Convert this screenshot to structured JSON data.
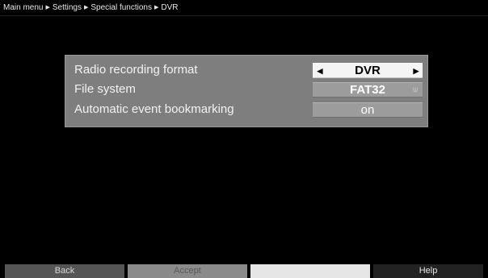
{
  "breadcrumb": [
    "Main menu",
    "Settings",
    "Special functions",
    "DVR"
  ],
  "breadcrumb_separator": "▶",
  "settings": [
    {
      "label": "Radio recording format",
      "value": "DVR",
      "selected": true
    },
    {
      "label": "File system",
      "value": "FAT32",
      "locked": true
    },
    {
      "label": "Automatic event bookmarking",
      "value": "on"
    }
  ],
  "arrows": {
    "left": "◀",
    "right": "▶"
  },
  "lock_glyph": "⍦",
  "function_keys": {
    "red": "Back",
    "green": "Accept",
    "yellow": "",
    "blue": "Help"
  },
  "colors": {
    "background": "#000000",
    "panel": "#7e7e7e",
    "selected_value": "#f4f4f4"
  }
}
